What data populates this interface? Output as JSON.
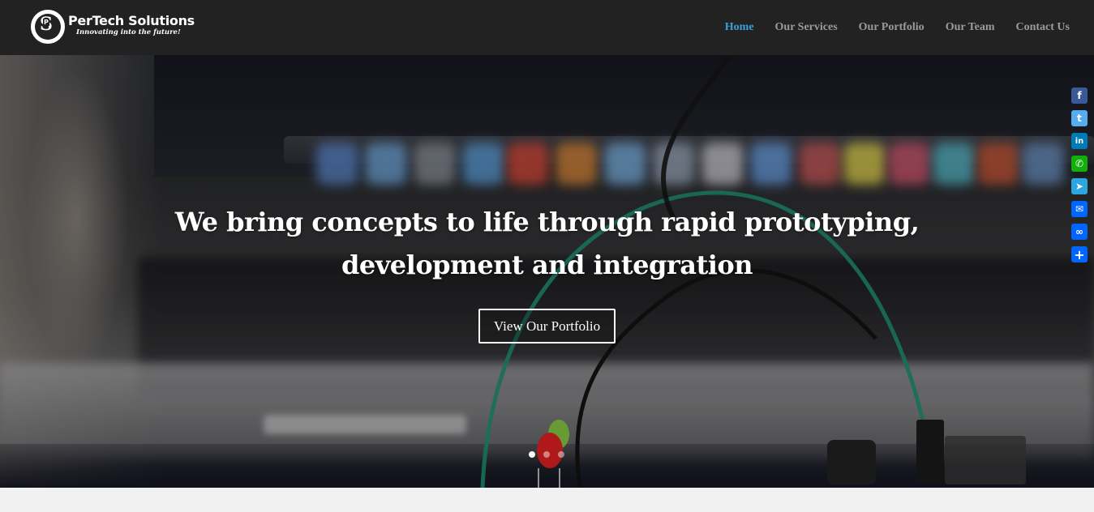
{
  "brand": {
    "name": "PerTech Solutions",
    "tagline": "Innovating into the future!",
    "mark_letters": [
      "S",
      "P"
    ]
  },
  "nav": {
    "items": [
      {
        "label": "Home",
        "active": true
      },
      {
        "label": "Our Services",
        "active": false
      },
      {
        "label": "Our Portfolio",
        "active": false
      },
      {
        "label": "Our Team",
        "active": false
      },
      {
        "label": "Contact Us",
        "active": false
      }
    ]
  },
  "hero": {
    "headline_line1": "We bring concepts to life through rapid prototyping,",
    "headline_line2": "development and integration",
    "cta_label": "View Our Portfolio",
    "slides": 3,
    "active_slide": 1
  },
  "share": [
    {
      "icon": "facebook-icon",
      "glyph": "f",
      "color": "#3b5998"
    },
    {
      "icon": "twitter-icon",
      "glyph": "t",
      "color": "#55acee"
    },
    {
      "icon": "linkedin-icon",
      "glyph": "in",
      "color": "#007bb5"
    },
    {
      "icon": "whatsapp-icon",
      "glyph": "✆",
      "color": "#12af0a"
    },
    {
      "icon": "telegram-icon",
      "glyph": "➤",
      "color": "#2ca5e0"
    },
    {
      "icon": "email-icon",
      "glyph": "✉",
      "color": "#0166ff"
    },
    {
      "icon": "copy-link-icon",
      "glyph": "∞",
      "color": "#0166ff"
    },
    {
      "icon": "share-icon",
      "glyph": "+",
      "color": "#0166ff"
    }
  ],
  "colors": {
    "header_bg": "#222222",
    "nav_active": "#3aa0d8",
    "nav_default": "#9b9b9b"
  }
}
